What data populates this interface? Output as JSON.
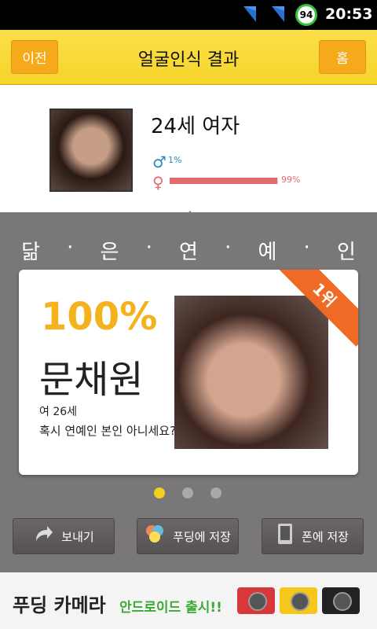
{
  "status_bar": {
    "battery": "94",
    "time": "20:53",
    "icons": [
      "signal-icon",
      "signal-icon",
      "battery-icon"
    ]
  },
  "title_bar": {
    "back_label": "이전",
    "title": "얼굴인식 결과",
    "home_label": "홈"
  },
  "profile": {
    "age_gender": "24세 여자",
    "male_percent": "1%",
    "female_percent": "99%",
    "female_fraction": 0.99,
    "male_icon": "♂",
    "female_icon": "♀"
  },
  "celeb_section": {
    "header_chars": [
      "닮",
      "·",
      "은",
      "·",
      "연",
      "·",
      "예",
      "·",
      "인"
    ]
  },
  "card": {
    "rank": "1위",
    "match_percent": "100%",
    "name": "문채원",
    "info": "여 26세",
    "question": "혹시 연예인 본인 아니세요?"
  },
  "pager": {
    "count": 3,
    "active": 0
  },
  "actions": {
    "send_label": "보내기",
    "pudding_label": "푸딩에 저장",
    "phone_label": "폰에 저장"
  },
  "ad": {
    "title": "푸딩 카메라",
    "subtitle": "안드로이드 출시!!"
  },
  "colors": {
    "accent_yellow": "#f6d42a",
    "button_orange": "#f7a91c",
    "match_yellow": "#f4b21e",
    "female_red": "#e46b6b",
    "male_blue": "#2a8bc2"
  }
}
